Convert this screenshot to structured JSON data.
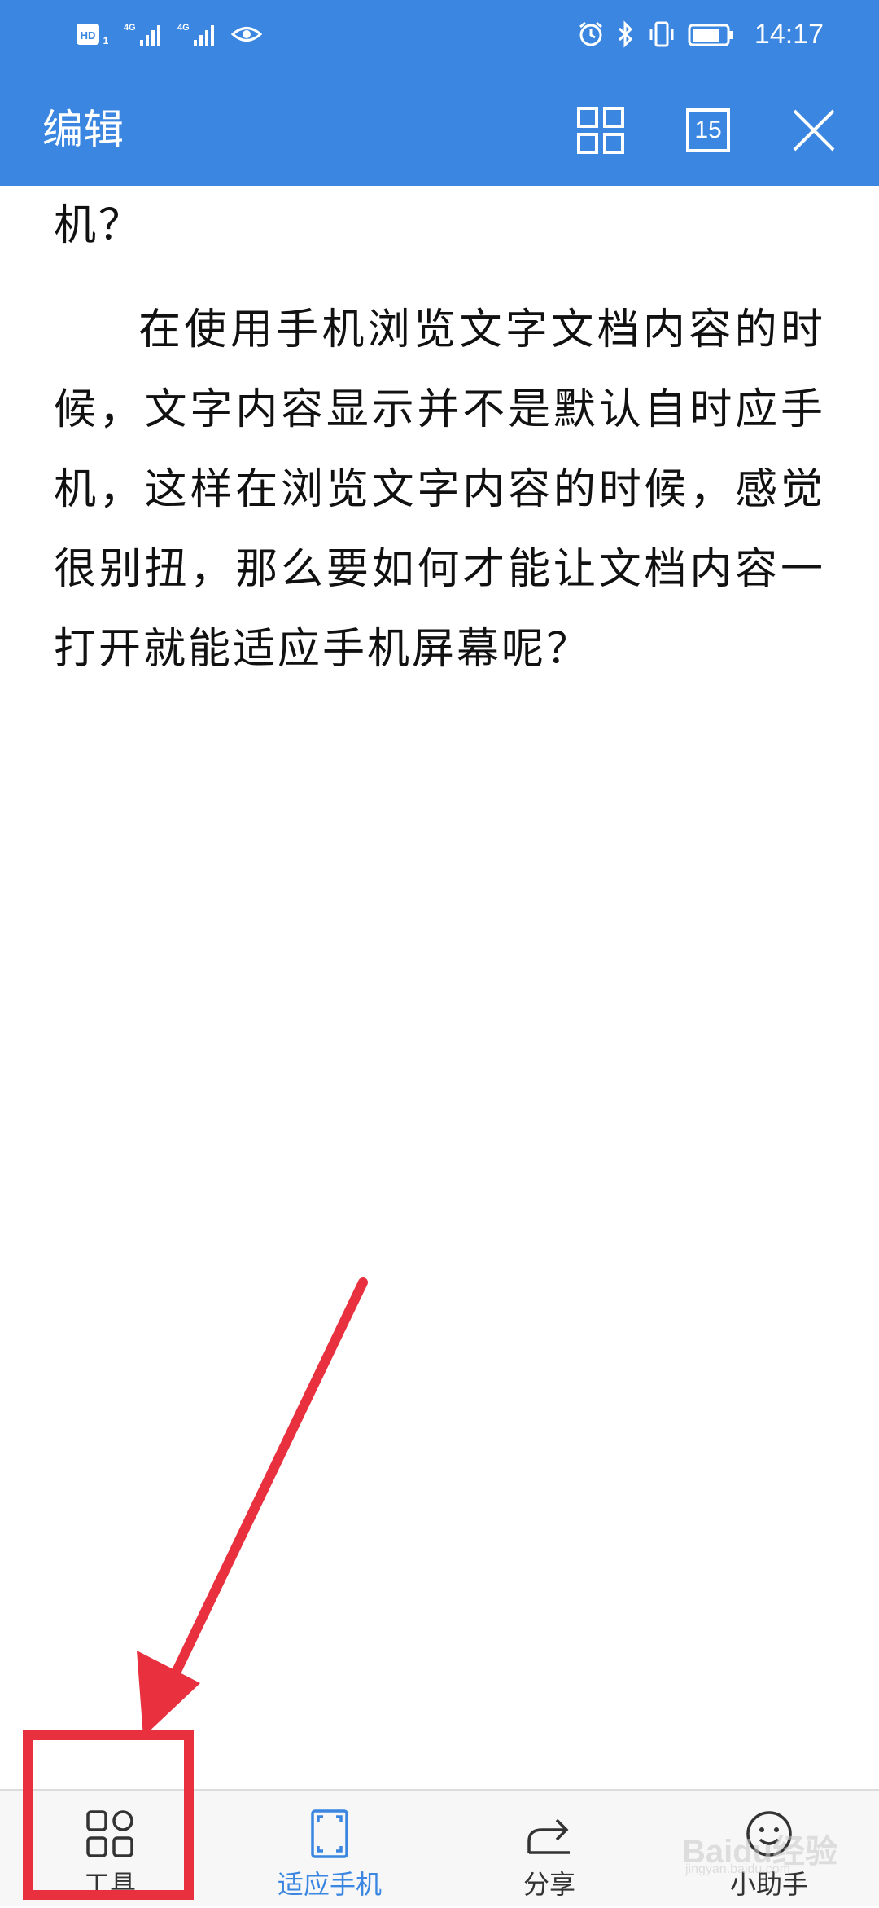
{
  "status_bar": {
    "left_badge": "HD",
    "left_sub": "1",
    "net1": "4G",
    "net2": "4G",
    "time": "14:17"
  },
  "header": {
    "title": "编辑",
    "pages_badge": "15"
  },
  "document": {
    "top_line": "机？",
    "paragraph": "在使用手机浏览文字文档内容的时候，文字内容显示并不是默认自时应手机，这样在浏览文字内容的时候，感觉很别扭，那么要如何才能让文档内容一打开就能适应手机屏幕呢？"
  },
  "toolbar": {
    "items": [
      {
        "label": "工具",
        "icon": "apps-grid-icon",
        "active": false
      },
      {
        "label": "适应手机",
        "icon": "fit-phone-icon",
        "active": true
      },
      {
        "label": "分享",
        "icon": "share-icon",
        "active": false
      },
      {
        "label": "小助手",
        "icon": "assistant-icon",
        "active": false
      }
    ]
  },
  "watermark": {
    "text": "Baidu经验",
    "sub": "jingyan.baidu.com"
  },
  "colors": {
    "accent": "#3a86e0",
    "annotation": "#e8303e"
  }
}
